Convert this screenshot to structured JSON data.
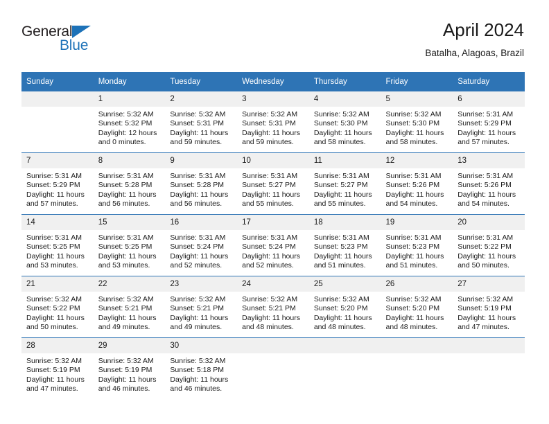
{
  "brand": {
    "name_part1": "General",
    "name_part2": "Blue",
    "triangle_color": "#1d72b8"
  },
  "header": {
    "title": "April 2024",
    "subtitle": "Batalha, Alagoas, Brazil",
    "header_bg": "#2e74b5",
    "daynum_bg": "#f0f0f0"
  },
  "weekdays": [
    "Sunday",
    "Monday",
    "Tuesday",
    "Wednesday",
    "Thursday",
    "Friday",
    "Saturday"
  ],
  "weeks": [
    [
      {
        "day": "",
        "sunrise": "",
        "sunset": "",
        "daylight_line1": "",
        "daylight_line2": ""
      },
      {
        "day": "1",
        "sunrise": "Sunrise: 5:32 AM",
        "sunset": "Sunset: 5:32 PM",
        "daylight_line1": "Daylight: 12 hours",
        "daylight_line2": "and 0 minutes."
      },
      {
        "day": "2",
        "sunrise": "Sunrise: 5:32 AM",
        "sunset": "Sunset: 5:31 PM",
        "daylight_line1": "Daylight: 11 hours",
        "daylight_line2": "and 59 minutes."
      },
      {
        "day": "3",
        "sunrise": "Sunrise: 5:32 AM",
        "sunset": "Sunset: 5:31 PM",
        "daylight_line1": "Daylight: 11 hours",
        "daylight_line2": "and 59 minutes."
      },
      {
        "day": "4",
        "sunrise": "Sunrise: 5:32 AM",
        "sunset": "Sunset: 5:30 PM",
        "daylight_line1": "Daylight: 11 hours",
        "daylight_line2": "and 58 minutes."
      },
      {
        "day": "5",
        "sunrise": "Sunrise: 5:32 AM",
        "sunset": "Sunset: 5:30 PM",
        "daylight_line1": "Daylight: 11 hours",
        "daylight_line2": "and 58 minutes."
      },
      {
        "day": "6",
        "sunrise": "Sunrise: 5:31 AM",
        "sunset": "Sunset: 5:29 PM",
        "daylight_line1": "Daylight: 11 hours",
        "daylight_line2": "and 57 minutes."
      }
    ],
    [
      {
        "day": "7",
        "sunrise": "Sunrise: 5:31 AM",
        "sunset": "Sunset: 5:29 PM",
        "daylight_line1": "Daylight: 11 hours",
        "daylight_line2": "and 57 minutes."
      },
      {
        "day": "8",
        "sunrise": "Sunrise: 5:31 AM",
        "sunset": "Sunset: 5:28 PM",
        "daylight_line1": "Daylight: 11 hours",
        "daylight_line2": "and 56 minutes."
      },
      {
        "day": "9",
        "sunrise": "Sunrise: 5:31 AM",
        "sunset": "Sunset: 5:28 PM",
        "daylight_line1": "Daylight: 11 hours",
        "daylight_line2": "and 56 minutes."
      },
      {
        "day": "10",
        "sunrise": "Sunrise: 5:31 AM",
        "sunset": "Sunset: 5:27 PM",
        "daylight_line1": "Daylight: 11 hours",
        "daylight_line2": "and 55 minutes."
      },
      {
        "day": "11",
        "sunrise": "Sunrise: 5:31 AM",
        "sunset": "Sunset: 5:27 PM",
        "daylight_line1": "Daylight: 11 hours",
        "daylight_line2": "and 55 minutes."
      },
      {
        "day": "12",
        "sunrise": "Sunrise: 5:31 AM",
        "sunset": "Sunset: 5:26 PM",
        "daylight_line1": "Daylight: 11 hours",
        "daylight_line2": "and 54 minutes."
      },
      {
        "day": "13",
        "sunrise": "Sunrise: 5:31 AM",
        "sunset": "Sunset: 5:26 PM",
        "daylight_line1": "Daylight: 11 hours",
        "daylight_line2": "and 54 minutes."
      }
    ],
    [
      {
        "day": "14",
        "sunrise": "Sunrise: 5:31 AM",
        "sunset": "Sunset: 5:25 PM",
        "daylight_line1": "Daylight: 11 hours",
        "daylight_line2": "and 53 minutes."
      },
      {
        "day": "15",
        "sunrise": "Sunrise: 5:31 AM",
        "sunset": "Sunset: 5:25 PM",
        "daylight_line1": "Daylight: 11 hours",
        "daylight_line2": "and 53 minutes."
      },
      {
        "day": "16",
        "sunrise": "Sunrise: 5:31 AM",
        "sunset": "Sunset: 5:24 PM",
        "daylight_line1": "Daylight: 11 hours",
        "daylight_line2": "and 52 minutes."
      },
      {
        "day": "17",
        "sunrise": "Sunrise: 5:31 AM",
        "sunset": "Sunset: 5:24 PM",
        "daylight_line1": "Daylight: 11 hours",
        "daylight_line2": "and 52 minutes."
      },
      {
        "day": "18",
        "sunrise": "Sunrise: 5:31 AM",
        "sunset": "Sunset: 5:23 PM",
        "daylight_line1": "Daylight: 11 hours",
        "daylight_line2": "and 51 minutes."
      },
      {
        "day": "19",
        "sunrise": "Sunrise: 5:31 AM",
        "sunset": "Sunset: 5:23 PM",
        "daylight_line1": "Daylight: 11 hours",
        "daylight_line2": "and 51 minutes."
      },
      {
        "day": "20",
        "sunrise": "Sunrise: 5:31 AM",
        "sunset": "Sunset: 5:22 PM",
        "daylight_line1": "Daylight: 11 hours",
        "daylight_line2": "and 50 minutes."
      }
    ],
    [
      {
        "day": "21",
        "sunrise": "Sunrise: 5:32 AM",
        "sunset": "Sunset: 5:22 PM",
        "daylight_line1": "Daylight: 11 hours",
        "daylight_line2": "and 50 minutes."
      },
      {
        "day": "22",
        "sunrise": "Sunrise: 5:32 AM",
        "sunset": "Sunset: 5:21 PM",
        "daylight_line1": "Daylight: 11 hours",
        "daylight_line2": "and 49 minutes."
      },
      {
        "day": "23",
        "sunrise": "Sunrise: 5:32 AM",
        "sunset": "Sunset: 5:21 PM",
        "daylight_line1": "Daylight: 11 hours",
        "daylight_line2": "and 49 minutes."
      },
      {
        "day": "24",
        "sunrise": "Sunrise: 5:32 AM",
        "sunset": "Sunset: 5:21 PM",
        "daylight_line1": "Daylight: 11 hours",
        "daylight_line2": "and 48 minutes."
      },
      {
        "day": "25",
        "sunrise": "Sunrise: 5:32 AM",
        "sunset": "Sunset: 5:20 PM",
        "daylight_line1": "Daylight: 11 hours",
        "daylight_line2": "and 48 minutes."
      },
      {
        "day": "26",
        "sunrise": "Sunrise: 5:32 AM",
        "sunset": "Sunset: 5:20 PM",
        "daylight_line1": "Daylight: 11 hours",
        "daylight_line2": "and 48 minutes."
      },
      {
        "day": "27",
        "sunrise": "Sunrise: 5:32 AM",
        "sunset": "Sunset: 5:19 PM",
        "daylight_line1": "Daylight: 11 hours",
        "daylight_line2": "and 47 minutes."
      }
    ],
    [
      {
        "day": "28",
        "sunrise": "Sunrise: 5:32 AM",
        "sunset": "Sunset: 5:19 PM",
        "daylight_line1": "Daylight: 11 hours",
        "daylight_line2": "and 47 minutes."
      },
      {
        "day": "29",
        "sunrise": "Sunrise: 5:32 AM",
        "sunset": "Sunset: 5:19 PM",
        "daylight_line1": "Daylight: 11 hours",
        "daylight_line2": "and 46 minutes."
      },
      {
        "day": "30",
        "sunrise": "Sunrise: 5:32 AM",
        "sunset": "Sunset: 5:18 PM",
        "daylight_line1": "Daylight: 11 hours",
        "daylight_line2": "and 46 minutes."
      },
      {
        "day": "",
        "sunrise": "",
        "sunset": "",
        "daylight_line1": "",
        "daylight_line2": ""
      },
      {
        "day": "",
        "sunrise": "",
        "sunset": "",
        "daylight_line1": "",
        "daylight_line2": ""
      },
      {
        "day": "",
        "sunrise": "",
        "sunset": "",
        "daylight_line1": "",
        "daylight_line2": ""
      },
      {
        "day": "",
        "sunrise": "",
        "sunset": "",
        "daylight_line1": "",
        "daylight_line2": ""
      }
    ]
  ]
}
